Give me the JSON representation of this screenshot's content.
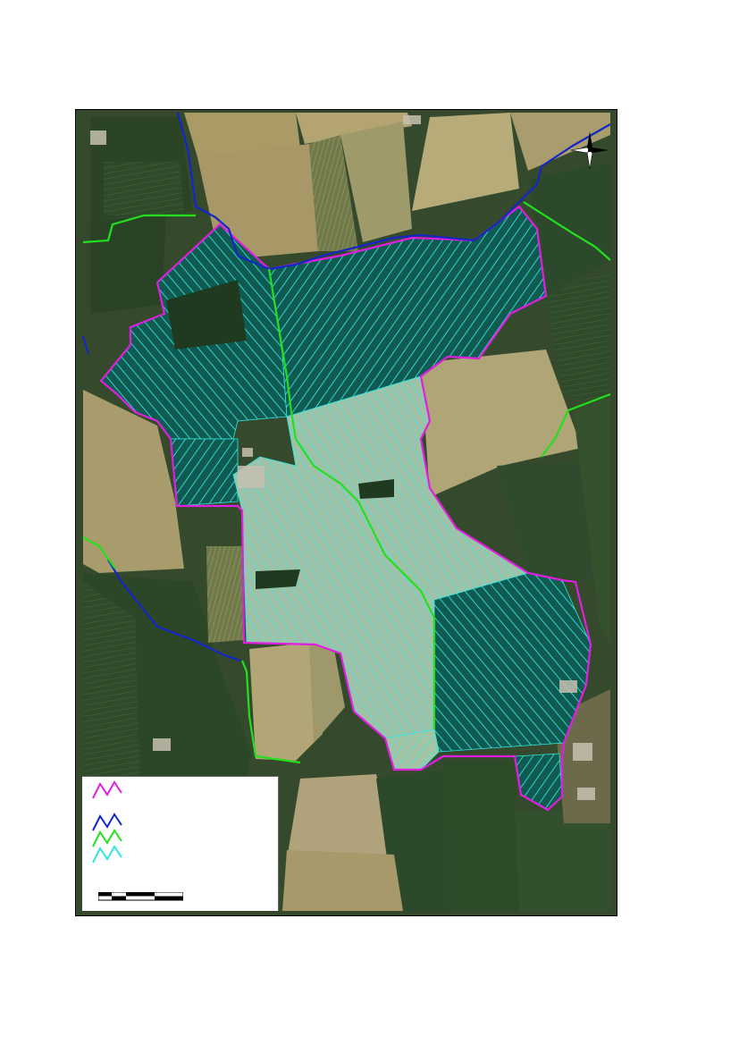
{
  "map": {
    "north_arrow_icon": "compass-rose-icon",
    "colors": {
      "farm_boundary": "#e01ee0",
      "watercourse": "#1426c8",
      "ditch": "#22e01e",
      "drains": "#2ee8e0",
      "drain_fill_dark": "#0f5b52",
      "drain_fill_light": "#7fb6b0"
    }
  },
  "legend": {
    "items": [
      {
        "name": "farm-boundary",
        "symbol": "zigzag-line",
        "color": "#e01ee0",
        "label": ""
      },
      {
        "name": "watercourse",
        "symbol": "zigzag-line",
        "color": "#1426c8",
        "label": ""
      },
      {
        "name": "ditch",
        "symbol": "zigzag-line",
        "color": "#22e01e",
        "label": ""
      },
      {
        "name": "drains",
        "symbol": "zigzag-line",
        "color": "#2ee8e0",
        "label": ""
      }
    ],
    "scale_label": ""
  }
}
